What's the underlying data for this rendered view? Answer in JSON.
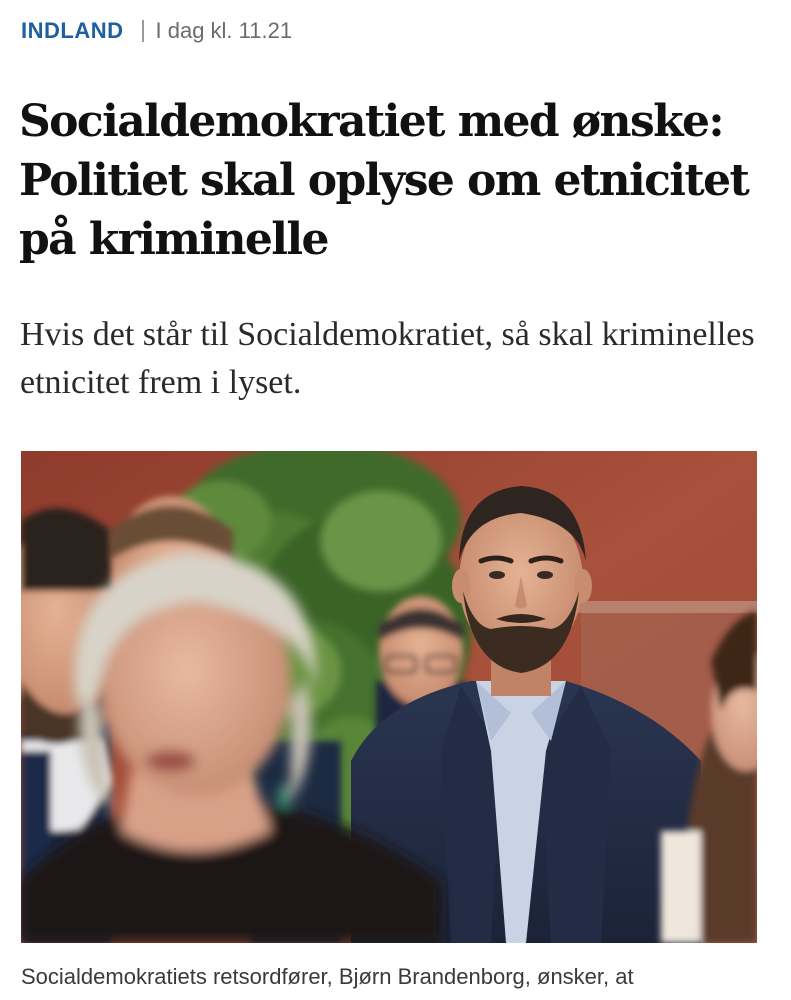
{
  "article": {
    "section": "INDLAND",
    "timestamp": "I dag kl. 11.21",
    "headline": "Socialdemokratiet med ønske: Politiet skal oplyse om etnicitet på kriminelle",
    "lead": "Hvis det står til Socialdemokratiet, så skal kriminelles etnicitet frem i lyset.",
    "caption": "Socialdemokratiets retsordfører, Bjørn Brandenborg, ønsker, at"
  },
  "colors": {
    "section": "#1f5fa0",
    "headline": "#111111",
    "background": "#ffffff"
  }
}
